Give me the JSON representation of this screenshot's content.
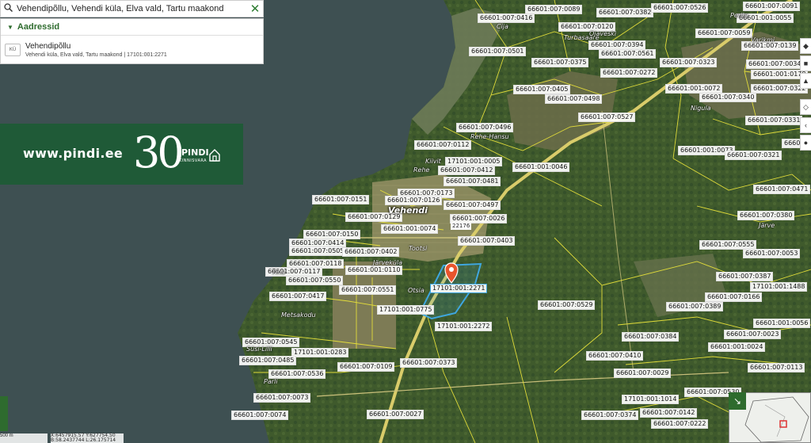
{
  "search": {
    "query": "Vehendipõllu, Vehendi küla, Elva vald, Tartu maakond",
    "clear_icon": "close-icon",
    "search_icon": "search-icon"
  },
  "results": {
    "header": "Aadressid",
    "items": [
      {
        "badge": "KÜ",
        "title": "Vehendipõllu",
        "subtitle": "Vehendi küla, Elva vald, Tartu maakond | 17101:001:2271"
      }
    ]
  },
  "banner": {
    "url": "www.pindi.ee",
    "number": "30",
    "brand": "PINDI",
    "sub": "KINNISVARA"
  },
  "map": {
    "village": "Vehendi",
    "selected_parcel": "17101:001:2271",
    "road_number": "22176",
    "places": [
      "Kiivit",
      "Rehe-Hansu",
      "Rehe",
      "Tootsi",
      "Järveküla",
      "Otsia",
      "Metsakodu",
      "Turbasaare",
      "Ojaveski",
      "Nigula",
      "Perila",
      "Varikmi",
      "Tina",
      "Süsi-Lilli",
      "Parli",
      "Cija",
      "Järve"
    ],
    "parcels": [
      "66601:007:0089",
      "66601:007:0382",
      "66601:007:0526",
      "66601:007:0091",
      "66601:007:0120",
      "66601:001:0055",
      "66601:007:0416",
      "66601:007:0059",
      "66601:007:0139",
      "66601:007:0394",
      "66601:007:0561",
      "66601:007:0501",
      "66601:007:0375",
      "66601:007:0323",
      "66601:007:0034",
      "66601:007:0272",
      "66601:001:0178",
      "66601:007:0405",
      "66601:001:0072",
      "66601:007:0322",
      "66601:007:0498",
      "66601:007:0340",
      "66601:007:0527",
      "66601:007:0331",
      "66601:007:0496",
      "66601:001:0073",
      "66601:001:002",
      "66601:007:0112",
      "17101:001:0005",
      "66601:007:0321",
      "66601:007:0412",
      "66601:001:0046",
      "66601:007:0481",
      "66601:007:0471",
      "66601:007:0173",
      "66601:007:0151",
      "66601:007:0126",
      "66601:007:0497",
      "66601:007:0380",
      "66601:007:0129",
      "66601:007:0026",
      "66601:001:0074",
      "66601:007:0150",
      "66601:007:0403",
      "66601:007:0414",
      "66601:007:0505",
      "66601:007:0402",
      "66601:007:0555",
      "66601:007:0053",
      "66601:007:0118",
      "66601:001:0110",
      "66601:007:0117",
      "66601:007:0387",
      "66601:007:0550",
      "66601:007:0551",
      "17101:001:1488",
      "66601:007:0417",
      "66601:007:0166",
      "66601:007:0529",
      "66601:007:0389",
      "17101:001:0775",
      "66601:001:0056",
      "17101:001:2272",
      "66601:007:0384",
      "66601:007:0023",
      "66601:007:0545",
      "66601:001:0024",
      "17101:001:0283",
      "66601:007:0410",
      "66601:007:0485",
      "66601:007:0373",
      "66601:007:0113",
      "66601:007:0109",
      "66601:007:0536",
      "66601:007:0029",
      "17101:001:1014",
      "66601:007:0530",
      "66601:007:0073",
      "66601:007:0374",
      "66601:007:0142",
      "66601:007:0074",
      "66601:007:0027",
      "66601:007:0222"
    ]
  },
  "footer": {
    "scale": "500 m",
    "coords_line1": "X:6457915.57 Y:627754.50",
    "coords_line2": "B:58.2437744 L:26.175714"
  },
  "colors": {
    "banner_bg": "#1f5a37",
    "parcel_line": "#e8e23a",
    "selected_parcel": "#3fa7e0",
    "marker": "#e8552d",
    "water": "#3d4f52"
  },
  "tools": [
    "layers-icon",
    "measure-icon",
    "print-icon",
    "share-icon",
    "info-icon",
    "home-icon"
  ]
}
